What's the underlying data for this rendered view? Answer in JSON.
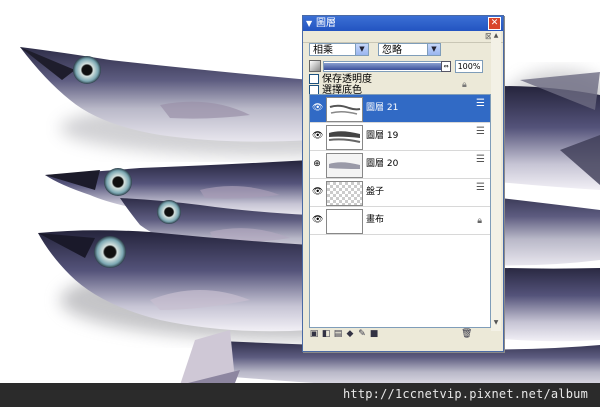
{
  "watermark": "http://1ccnetvip.pixnet.net/album",
  "panel": {
    "title": "圖層",
    "title_arrow_icon": "collapse-arrow-icon",
    "close_icon": "close-icon",
    "blend_mode": "相乘",
    "composite_mode": "忽略",
    "opacity_percent": 100,
    "opacity_label": "100%",
    "preserve_transparency_label": "保存透明度",
    "select_base_color_label": "選擇底色",
    "layers": [
      {
        "name": "圖層 21",
        "selected": true,
        "visible_icon": "eye-icon",
        "right_icon": "stack-icon"
      },
      {
        "name": "圖層 19",
        "selected": false,
        "visible_icon": "eye-icon",
        "right_icon": "stack-icon"
      },
      {
        "name": "圖層 20",
        "selected": false,
        "visible_icon": "link-icon",
        "right_icon": "stack-icon"
      },
      {
        "name": "盤子",
        "selected": false,
        "visible_icon": "eye-icon",
        "right_icon": "stack-icon"
      },
      {
        "name": "畫布",
        "selected": false,
        "visible_icon": "eye-icon",
        "right_icon": "lock-icon"
      }
    ],
    "bottom_tools": [
      "new-layer-icon",
      "mask-icon",
      "group-icon",
      "paint-bucket-icon",
      "brush-icon",
      "fill-icon",
      "trash-icon"
    ]
  },
  "colors": {
    "title_blue": "#2354c1",
    "selection_blue": "#316ac5",
    "panel_bg": "#ece9d8"
  }
}
